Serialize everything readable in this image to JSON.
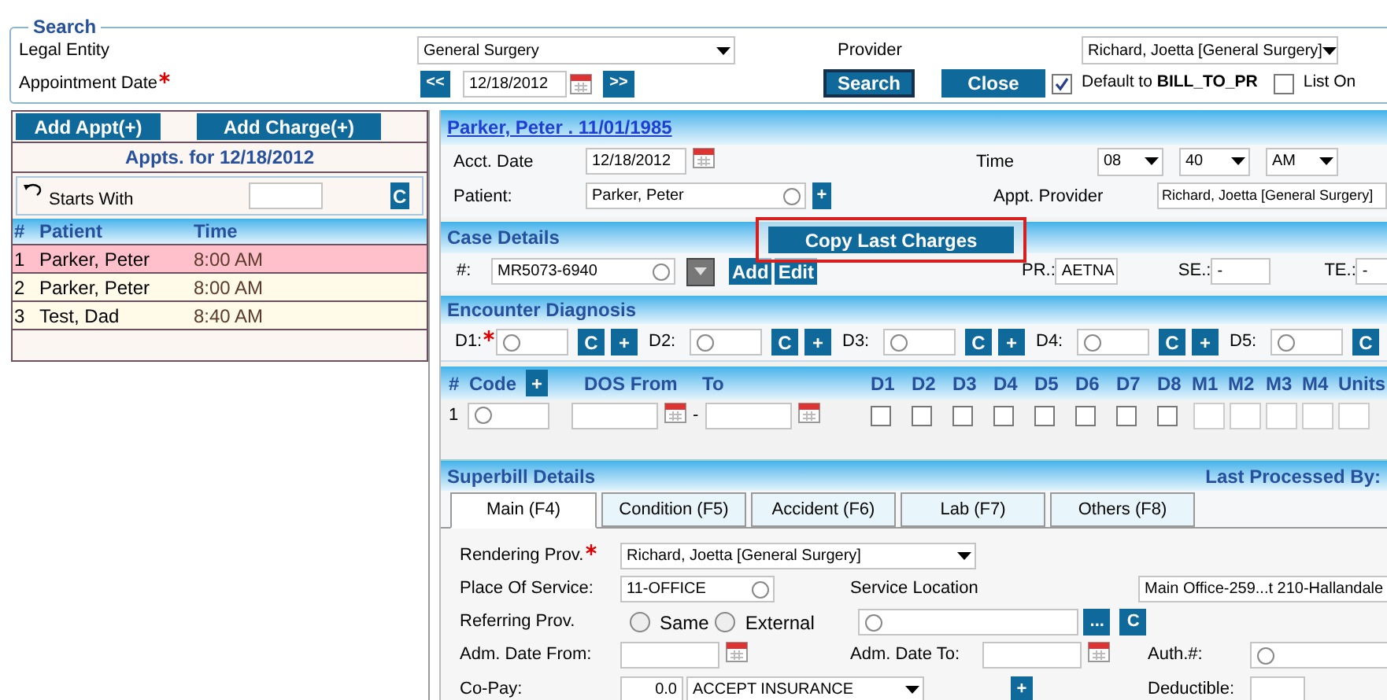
{
  "search": {
    "title": "Search",
    "legal_entity": {
      "label": "Legal Entity",
      "value": "General Surgery"
    },
    "provider": {
      "label": "Provider",
      "value": "Richard, Joetta [General Surgery]"
    },
    "appointment_date": {
      "label": "Appointment Date",
      "required": true,
      "prev": "<<",
      "value": "12/18/2012",
      "next": ">>"
    },
    "buttons": [
      "Search",
      "Close"
    ],
    "checkboxes": [
      {
        "label": "Default to **BILL_TO_PR**",
        "checked": true
      },
      {
        "label": "List On",
        "checked": false
      }
    ]
  },
  "appointments": {
    "buttons": [
      "Add Appt(+)",
      "Add Charge(+)"
    ],
    "title": "Appts. for 12/18/2012",
    "filter": {
      "label": "Starts With",
      "clear": "C"
    },
    "columns": [
      "#",
      "Patient",
      "Time"
    ],
    "rows": [
      {
        "cells": [
          "1",
          "Parker, Peter",
          "8:00 AM"
        ],
        "selected": true
      },
      {
        "cells": [
          "2",
          "Parker, Peter",
          "8:00 AM"
        ],
        "selected": false
      },
      {
        "cells": [
          "3",
          "Test, Dad",
          "8:40 AM"
        ],
        "selected": false
      }
    ]
  },
  "charge": {
    "patient_link": "Parker, Peter . 11/01/1985",
    "acct_date": {
      "label": "Acct. Date",
      "value": "12/18/2012"
    },
    "time": {
      "label": "Time",
      "hour": "08",
      "minute": "40",
      "meridiem": "AM"
    },
    "patient": {
      "label": "Patient:",
      "value": "Parker, Peter",
      "add": "+"
    },
    "appt_provider": {
      "label": "Appt. Provider",
      "value": "Richard, Joetta [General Surgery]"
    },
    "copy_button": "Copy Last Charges",
    "case_details": {
      "title": "Case Details",
      "label": "#:",
      "value": "MR5073-6940",
      "buttons": [
        "Add",
        "Edit"
      ],
      "insurances": [
        {
          "label": "PR.:",
          "value": "AETNA"
        },
        {
          "label": "SE.:",
          "value": "-"
        },
        {
          "label": "TE.:",
          "value": "-"
        }
      ]
    },
    "diagnosis": {
      "title": "Encounter Diagnosis",
      "slots": [
        {
          "label": "D1:",
          "required": true,
          "buttons": [
            "C",
            "+"
          ]
        },
        {
          "label": "D2:",
          "required": false,
          "buttons": [
            "C",
            "+"
          ]
        },
        {
          "label": "D3:",
          "required": false,
          "buttons": [
            "C",
            "+"
          ]
        },
        {
          "label": "D4:",
          "required": false,
          "buttons": [
            "C",
            "+"
          ]
        },
        {
          "label": "D5:",
          "required": false,
          "buttons": [
            "C"
          ]
        }
      ]
    },
    "procedures": {
      "columns": [
        "#",
        "Code",
        "DOS From",
        "To",
        "D1",
        "D2",
        "D3",
        "D4",
        "D5",
        "D6",
        "D7",
        "D8",
        "M1",
        "M2",
        "M3",
        "M4",
        "Units"
      ],
      "add": "+",
      "rows": [
        {
          "number": "1",
          "separator": "-",
          "checks": [
            false,
            false,
            false,
            false,
            false,
            false,
            false,
            false
          ]
        }
      ]
    },
    "superbill": {
      "title": "Superbill Details",
      "last_processed": "Last Processed By:",
      "tabs": [
        {
          "label": "Main (F4)",
          "selected": true
        },
        {
          "label": "Condition (F5)",
          "selected": false
        },
        {
          "label": "Accident (F6)",
          "selected": false
        },
        {
          "label": "Lab (F7)",
          "selected": false
        },
        {
          "label": "Others (F8)",
          "selected": false
        }
      ],
      "rendering_prov": {
        "label": "Rendering Prov.",
        "required": true,
        "value": "Richard, Joetta [General Surgery]"
      },
      "place_of_service": {
        "label": "Place Of Service:",
        "value": "11-OFFICE"
      },
      "service_location": {
        "label": "Service Location",
        "value": "Main Office-259...t 210-Hallandale"
      },
      "referring_prov": {
        "label": "Referring Prov.",
        "options": [
          {
            "label": "Same",
            "selected": false
          },
          {
            "label": "External",
            "selected": false
          }
        ],
        "buttons": [
          "...",
          "C"
        ]
      },
      "adm_date_from": {
        "label": "Adm. Date From:"
      },
      "adm_date_to": {
        "label": "Adm. Date To:"
      },
      "auth": {
        "label": "Auth.#:"
      },
      "co_pay": {
        "label": "Co-Pay:",
        "value": "0.0",
        "plan": "ACCEPT INSURANCE",
        "add": "+"
      },
      "deductible": {
        "label": "Deductible:"
      }
    }
  }
}
